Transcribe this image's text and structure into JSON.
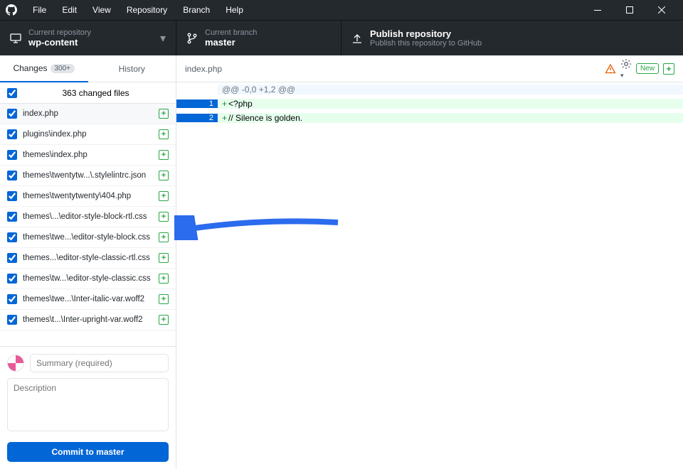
{
  "menubar": [
    "File",
    "Edit",
    "View",
    "Repository",
    "Branch",
    "Help"
  ],
  "repo": {
    "label": "Current repository",
    "value": "wp-content"
  },
  "branch": {
    "label": "Current branch",
    "value": "master"
  },
  "publish": {
    "title": "Publish repository",
    "sub": "Publish this repository to GitHub"
  },
  "tabs": {
    "changes": "Changes",
    "changes_count": "300+",
    "history": "History"
  },
  "changed_header": "363 changed files",
  "files": [
    "index.php",
    "plugins\\index.php",
    "themes\\index.php",
    "themes\\twentytw...\\.stylelintrc.json",
    "themes\\twentytwenty\\404.php",
    "themes\\...\\editor-style-block-rtl.css",
    "themes\\twe...\\editor-style-block.css",
    "themes...\\editor-style-classic-rtl.css",
    "themes\\tw...\\editor-style-classic.css",
    "themes\\twe...\\Inter-italic-var.woff2",
    "themes\\t...\\Inter-upright-var.woff2"
  ],
  "commit": {
    "summary_ph": "Summary (required)",
    "desc_ph": "Description",
    "button_prefix": "Commit to ",
    "button_branch": "master"
  },
  "diff": {
    "filename": "index.php",
    "new_label": "New",
    "hunk": "@@ -0,0 +1,2 @@",
    "lines": [
      {
        "n": "1",
        "text": "<?php"
      },
      {
        "n": "2",
        "text": "// Silence is golden."
      }
    ]
  }
}
